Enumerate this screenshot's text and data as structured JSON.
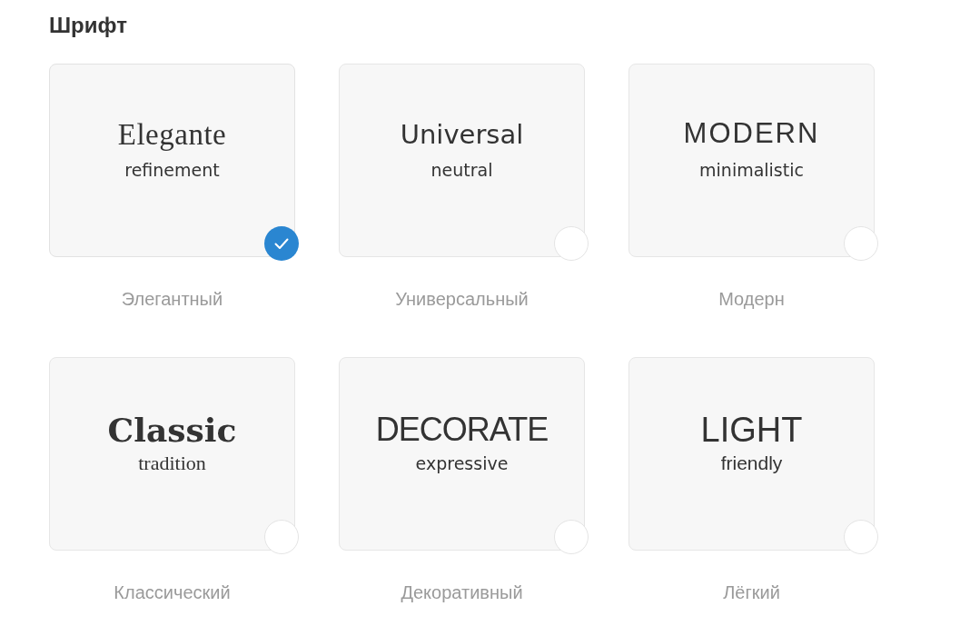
{
  "section": {
    "title": "Шрифт"
  },
  "fonts": [
    {
      "kind": "elegant",
      "sample": "Elegante",
      "caption": "refinement",
      "label": "Элегантный",
      "selected": true
    },
    {
      "kind": "universal",
      "sample": "Universal",
      "caption": "neutral",
      "label": "Универсальный",
      "selected": false
    },
    {
      "kind": "modern",
      "sample": "MODERN",
      "caption": "minimalistic",
      "label": "Модерн",
      "selected": false
    },
    {
      "kind": "classic",
      "sample": "Classic",
      "caption": "tradition",
      "label": "Классический",
      "selected": false
    },
    {
      "kind": "decorative",
      "sample": "DECORATE",
      "caption": "expressive",
      "label": "Декоративный",
      "selected": false
    },
    {
      "kind": "light",
      "sample": "LIGHT",
      "caption": "friendly",
      "label": "Лёгкий",
      "selected": false
    }
  ]
}
